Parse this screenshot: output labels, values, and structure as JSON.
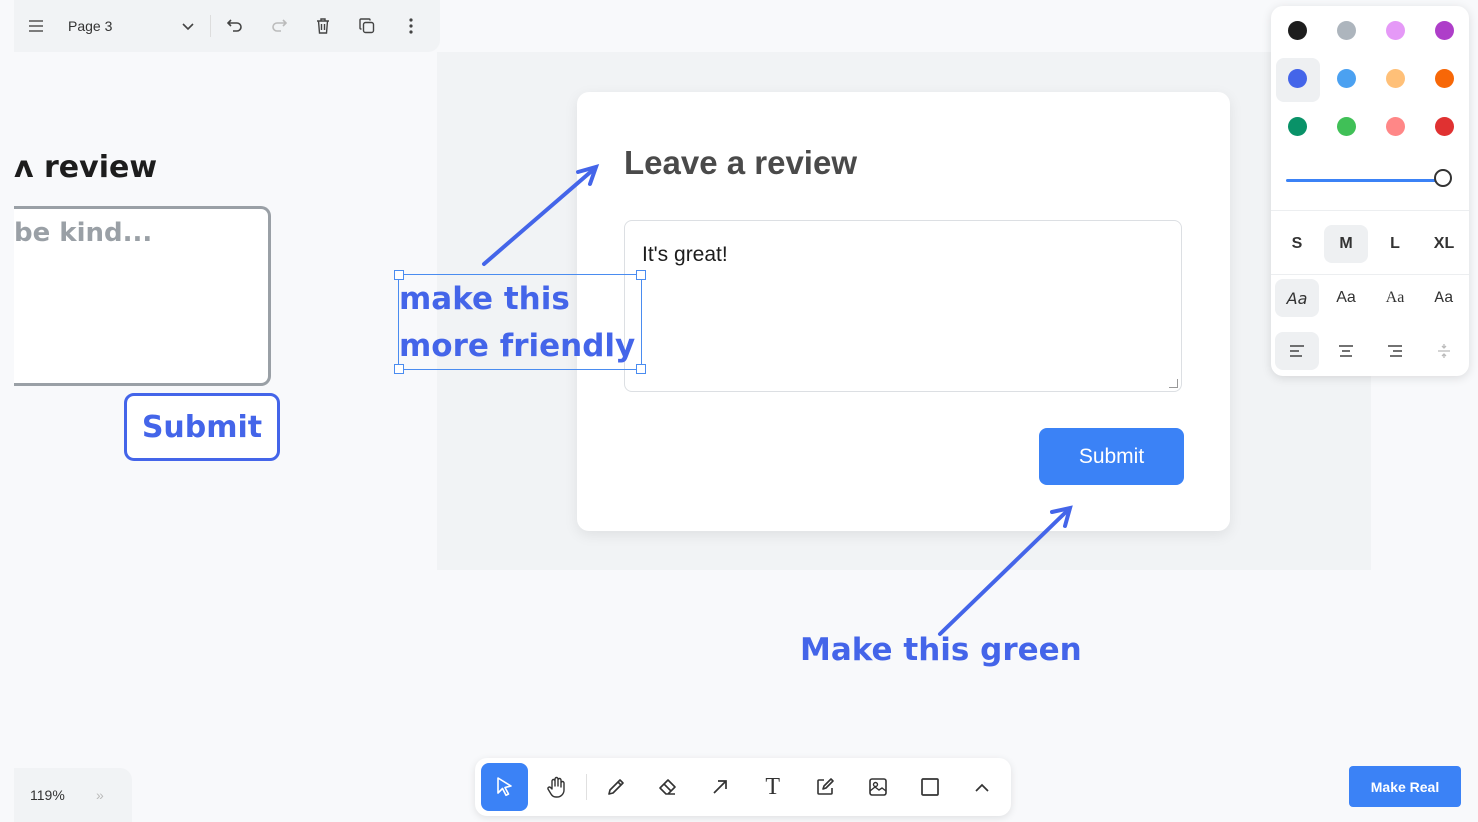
{
  "menubar": {
    "page_name": "Page 3",
    "icons": [
      "hamburger-menu-icon",
      "chevron-down-icon",
      "undo-icon",
      "redo-icon",
      "trash-icon",
      "duplicate-icon",
      "more-vertical-icon"
    ]
  },
  "wireframe": {
    "title_fragment": "ʌ review",
    "placeholder_fragment": "be kind...",
    "submit_label": "Submit"
  },
  "review_card": {
    "title": "Leave a review",
    "textarea_value": "It's great!",
    "submit_label": "Submit",
    "submit_color": "#3b82f6"
  },
  "annotations": {
    "friendly_line1": "make this",
    "friendly_line2": "more friendly",
    "green_note": "Make this green",
    "ink_color": "#4465e9"
  },
  "style_panel": {
    "colors": [
      "#1d1d1d",
      "#adb5bd",
      "#e599f7",
      "#ae3ec9",
      "#4465e9",
      "#4ba1f1",
      "#ffc078",
      "#f76707",
      "#099268",
      "#40c057",
      "#ff8787",
      "#e03131"
    ],
    "selected_color_index": 4,
    "opacity": 1.0,
    "sizes": [
      "S",
      "M",
      "L",
      "XL"
    ],
    "selected_size": "M",
    "font_samples": [
      "Aa",
      "Aa",
      "Aa",
      "Aa"
    ],
    "selected_font_index": 0,
    "align_icons": [
      "align-left-icon",
      "align-center-icon",
      "align-right-icon",
      "vertical-align-icon"
    ]
  },
  "zoom": {
    "level": "119%",
    "chevrons": "»"
  },
  "toolbar": {
    "tools": [
      "select-icon",
      "hand-icon",
      "pencil-icon",
      "eraser-icon",
      "arrow-icon",
      "text-icon",
      "note-icon",
      "image-icon",
      "rectangle-icon",
      "chevron-up-icon"
    ],
    "text_tool_glyph": "T",
    "active": "select-icon"
  },
  "make_real": {
    "label": "Make Real"
  }
}
